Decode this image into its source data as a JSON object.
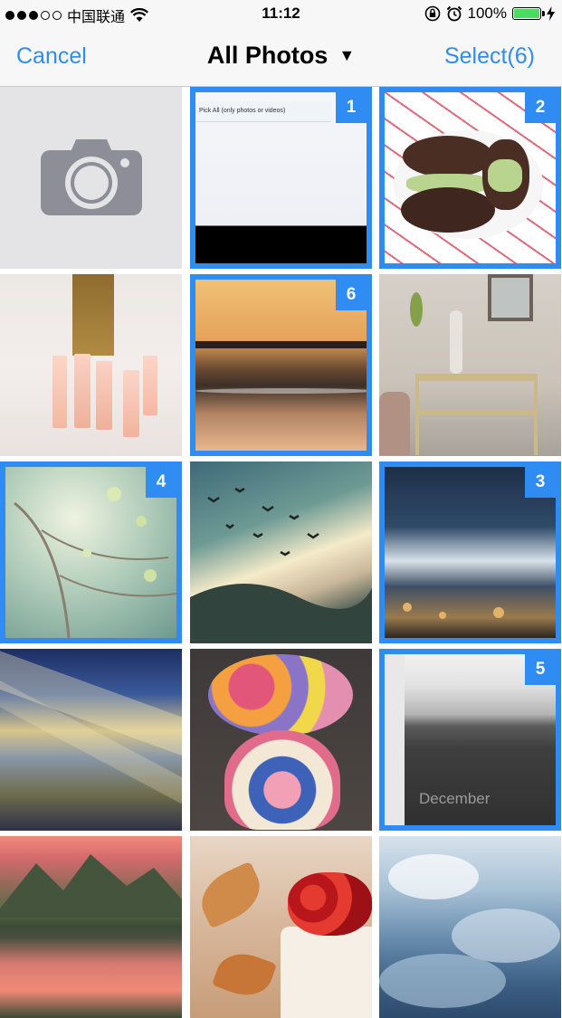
{
  "status": {
    "carrier": "中国联通",
    "signal_dots": 5,
    "signal_filled": 3,
    "time": "11:12",
    "battery_percent": "100%",
    "battery_level": 1.0
  },
  "nav": {
    "cancel_label": "Cancel",
    "title": "All Photos",
    "title_caret": "▼",
    "select_label": "Select(6)"
  },
  "screenshot_thumb_text": "Pick All (only photos or videos)",
  "december_text": "December",
  "colors": {
    "accent": "#2f8cf2",
    "battery": "#4cd964"
  },
  "grid": {
    "camera_icon": "camera-icon",
    "photos": [
      {
        "name": "photo-app-screenshot",
        "selected": true,
        "order": "1"
      },
      {
        "name": "photo-ice-cream-sandwich",
        "selected": true,
        "order": "2"
      },
      {
        "name": "photo-champagne-glasses",
        "selected": false,
        "order": ""
      },
      {
        "name": "photo-pier-sunset",
        "selected": true,
        "order": "6"
      },
      {
        "name": "photo-console-table",
        "selected": false,
        "order": ""
      },
      {
        "name": "photo-spring-branches",
        "selected": true,
        "order": "4"
      },
      {
        "name": "photo-birds-sunrise",
        "selected": false,
        "order": ""
      },
      {
        "name": "photo-ocean-wave",
        "selected": true,
        "order": "3"
      },
      {
        "name": "photo-sun-rays-clouds",
        "selected": false,
        "order": ""
      },
      {
        "name": "photo-flower-vase",
        "selected": false,
        "order": ""
      },
      {
        "name": "photo-december-field",
        "selected": true,
        "order": "5"
      },
      {
        "name": "photo-mountain-lake",
        "selected": false,
        "order": ""
      },
      {
        "name": "photo-cherries-leaves",
        "selected": false,
        "order": ""
      },
      {
        "name": "photo-sky-clouds",
        "selected": false,
        "order": ""
      }
    ]
  }
}
